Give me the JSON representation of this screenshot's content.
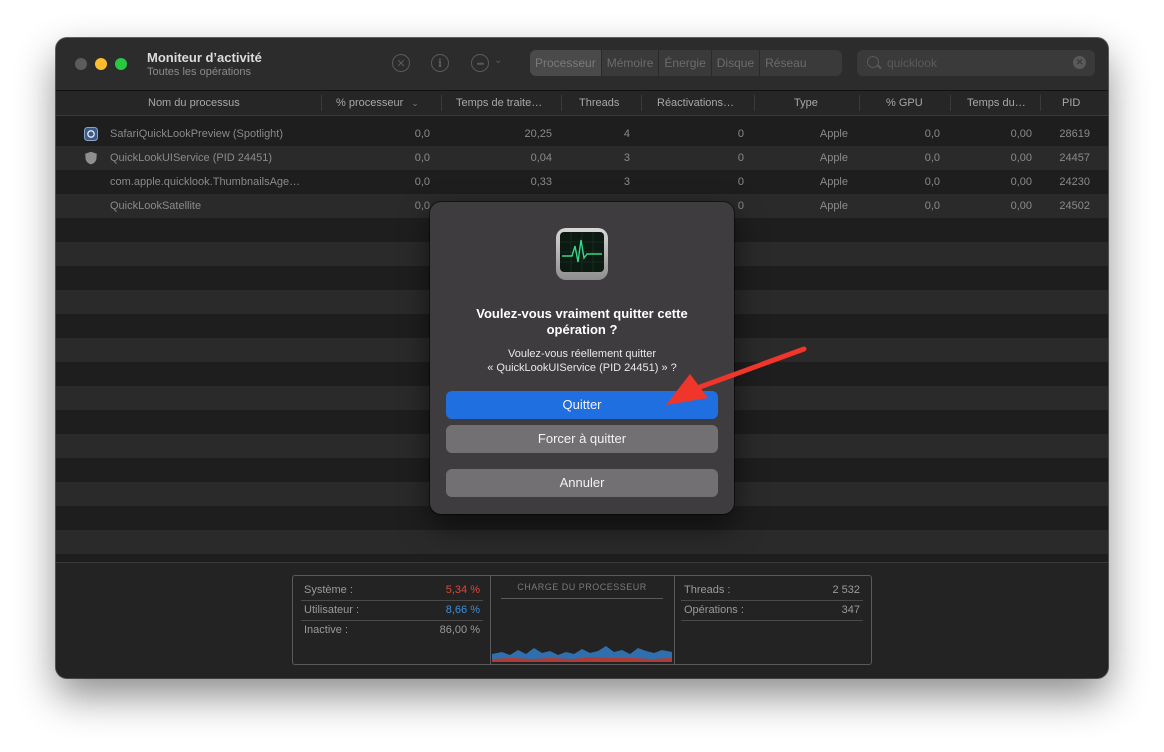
{
  "window": {
    "title": "Moniteur d’activité",
    "subtitle": "Toutes les opérations"
  },
  "toolbar": {
    "stop_icon": "x-circle-icon",
    "info_icon": "info-icon",
    "more_icon": "ellipsis-circle-icon",
    "tabs": [
      {
        "label": "Processeur",
        "active": true
      },
      {
        "label": "Mémoire",
        "active": false
      },
      {
        "label": "Énergie",
        "active": false
      },
      {
        "label": "Disque",
        "active": false
      },
      {
        "label": "Réseau",
        "active": false
      }
    ],
    "search_value": "quicklook"
  },
  "table": {
    "columns": [
      "Nom du processus",
      "% processeur",
      "Temps de traite…",
      "Threads",
      "Réactivations…",
      "Type",
      "% GPU",
      "Temps du…",
      "PID"
    ],
    "rows": [
      {
        "name": "SafariQuickLookPreview (Spotlight)",
        "cpu": "0,0",
        "time": "20,25",
        "threads": "4",
        "wakeups": "0",
        "type": "Apple",
        "gpu": "0,0",
        "gputime": "0,00",
        "pid": "28619",
        "icon": "preview-app-icon"
      },
      {
        "name": "QuickLookUIService (PID 24451)",
        "cpu": "0,0",
        "time": "0,04",
        "threads": "3",
        "wakeups": "0",
        "type": "Apple",
        "gpu": "0,0",
        "gputime": "0,00",
        "pid": "24457",
        "icon": "shield-icon"
      },
      {
        "name": "com.apple.quicklook.ThumbnailsAge…",
        "cpu": "0,0",
        "time": "0,33",
        "threads": "3",
        "wakeups": "0",
        "type": "Apple",
        "gpu": "0,0",
        "gputime": "0,00",
        "pid": "24230",
        "icon": ""
      },
      {
        "name": "QuickLookSatellite",
        "cpu": "0,0",
        "time": "",
        "threads": "",
        "wakeups": "0",
        "type": "Apple",
        "gpu": "0,0",
        "gputime": "0,00",
        "pid": "24502",
        "icon": ""
      }
    ]
  },
  "stats": {
    "system_label": "Système :",
    "system_value": "5,34 %",
    "user_label": "Utilisateur :",
    "user_value": "8,66 %",
    "idle_label": "Inactive :",
    "idle_value": "86,00 %",
    "chart_title": "CHARGE DU PROCESSEUR",
    "threads_label": "Threads :",
    "threads_value": "2 532",
    "processes_label": "Opérations :",
    "processes_value": "347",
    "colors": {
      "system": "#e0463a",
      "user": "#3a8fe0"
    }
  },
  "dialog": {
    "title": "Voulez-vous vraiment quitter cette opération ?",
    "message_line1": "Voulez-vous réellement quitter",
    "message_line2": "« QuickLookUIService (PID 24451) » ?",
    "quit_label": "Quitter",
    "force_label": "Forcer à quitter",
    "cancel_label": "Annuler",
    "icon": "activity-monitor-app-icon"
  },
  "annotation": {
    "icon": "red-arrow-annotation",
    "color": "#f0352a"
  }
}
